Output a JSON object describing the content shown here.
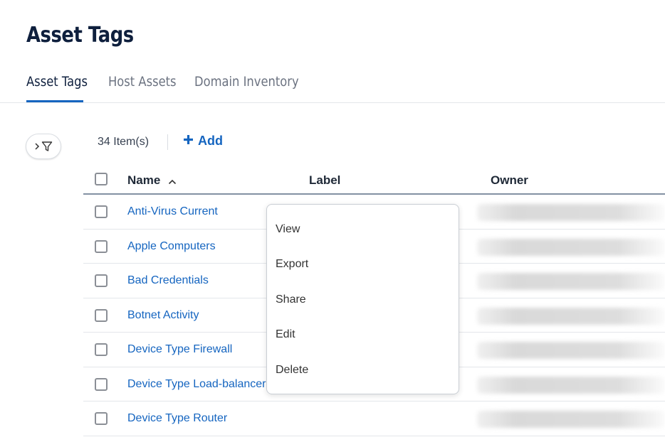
{
  "page": {
    "title": "Asset Tags"
  },
  "tabs": [
    {
      "label": "Asset Tags",
      "active": true
    },
    {
      "label": "Host Assets",
      "active": false
    },
    {
      "label": "Domain Inventory",
      "active": false
    }
  ],
  "toolbar": {
    "item_count": "34 Item(s)",
    "add_label": "Add"
  },
  "table": {
    "columns": {
      "name": "Name",
      "label": "Label",
      "owner": "Owner"
    },
    "sort": {
      "column": "Name",
      "direction": "ascending"
    },
    "rows": [
      {
        "name": "Anti-Virus Current"
      },
      {
        "name": "Apple Computers"
      },
      {
        "name": "Bad Credentials"
      },
      {
        "name": "Botnet Activity"
      },
      {
        "name": "Device Type Firewall"
      },
      {
        "name": "Device Type Load-balancer"
      },
      {
        "name": "Device Type Router"
      }
    ]
  },
  "context_menu": {
    "items": [
      "View",
      "Export",
      "Share",
      "Edit",
      "Delete"
    ]
  },
  "colors": {
    "accent": "#1565c0",
    "title": "#0e1f3d",
    "link": "#1565c0"
  },
  "icons": {
    "filter": "funnel-icon",
    "expand": "chevron-right-icon",
    "add": "plus-icon",
    "sort": "chevron-up-icon"
  }
}
